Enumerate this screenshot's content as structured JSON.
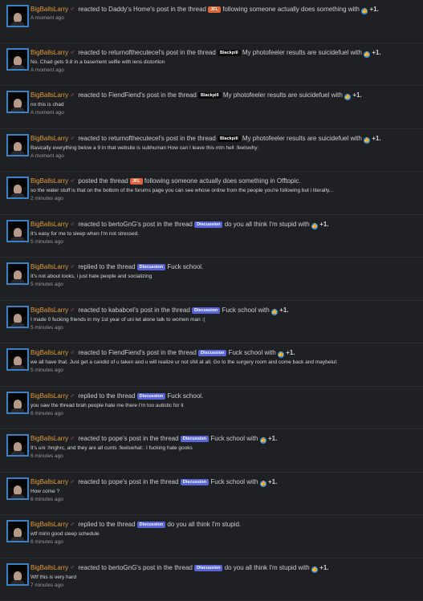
{
  "items": [
    {
      "user": "BigBallsLarry",
      "action": "reacted to Daddy's Home's post in the thread",
      "tag": "JFL",
      "tagType": "jfl",
      "thread": "following someone actually does something with",
      "reaction": "+1.",
      "snippet": "",
      "time": "A moment ago"
    },
    {
      "user": "BigBallsLarry",
      "action": "reacted to returnofthecutecel's post in the thread",
      "tag": "Blackpill",
      "tagType": "bp",
      "thread": "My photofeeler results are suicidefuel with",
      "reaction": "+1.",
      "snippet": "No. Chad gets 9.8 in a basement selfie with lens distortion",
      "time": "A moment ago"
    },
    {
      "user": "BigBallsLarry",
      "action": "reacted to FiendFiend's post in the thread",
      "tag": "Blackpill",
      "tagType": "bp",
      "thread": "My photofeeler results are suicidefuel with",
      "reaction": "+1.",
      "snippet": "no this is chad",
      "time": "A moment ago"
    },
    {
      "user": "BigBallsLarry",
      "action": "reacted to returnofthecutecel's post in the thread",
      "tag": "Blackpill",
      "tagType": "bp",
      "thread": "My photofeeler results are suicidefuel with",
      "reaction": "+1.",
      "snippet": "Basically everything below a 9 in that website is subhuman How can I leave this mtn hell :feelswhy:",
      "time": "A moment ago"
    },
    {
      "user": "BigBallsLarry",
      "action": "posted the thread",
      "tag": "JFL",
      "tagType": "jfl",
      "thread": "following someone actually does something in Offtopic.",
      "reaction": "",
      "snippet": "so the water stuff is that on the bottom of the forums page you can see whose online from the people you're following but i literally...",
      "time": "2 minutes ago"
    },
    {
      "user": "BigBallsLarry",
      "action": "reacted to bertoGnG's post in the thread",
      "tag": "Discussion",
      "tagType": "disc",
      "thread": "do you all think I'm stupid with",
      "reaction": "+1.",
      "snippet": "It's easy for me to sleep when I'm not stressed.",
      "time": "5 minutes ago"
    },
    {
      "user": "BigBallsLarry",
      "action": "replied to the thread",
      "tag": "Discussion",
      "tagType": "disc",
      "thread": "Fuck school.",
      "reaction": "",
      "snippet": "It's not about looks, i just hate people and socializing",
      "time": "5 minutes ago"
    },
    {
      "user": "BigBallsLarry",
      "action": "reacted to kababcel's post in the thread",
      "tag": "Discussion",
      "tagType": "disc",
      "thread": "Fuck school with",
      "reaction": "+1.",
      "snippet": "I made 0 fucking friends in my 1st year of uni let alone talk to women man :(",
      "time": "5 minutes ago"
    },
    {
      "user": "BigBallsLarry",
      "action": "reacted to FiendFiend's post in the thread",
      "tag": "Discussion",
      "tagType": "disc",
      "thread": "Fuck school with",
      "reaction": "+1.",
      "snippet": "we all have that. Just get a candid of u taken and u will realize ur not shit at all. Go to the surgery room and come back and maybelul:",
      "time": "5 minutes ago"
    },
    {
      "user": "BigBallsLarry",
      "action": "replied to the thread",
      "tag": "Discussion",
      "tagType": "disc",
      "thread": "Fuck school.",
      "reaction": "",
      "snippet": "you saw the thread brah people hate me there I'm too autistic for it",
      "time": "6 minutes ago"
    },
    {
      "user": "BigBallsLarry",
      "action": "reacted to pope's post in the thread",
      "tag": "Discussion",
      "tagType": "disc",
      "thread": "Fuck school with",
      "reaction": "+1.",
      "snippet": "It's uni :hnghrc, and they are all cunts :feelswhat:. I fucking hate gooks",
      "time": "6 minutes ago"
    },
    {
      "user": "BigBallsLarry",
      "action": "reacted to pope's post in the thread",
      "tag": "Discussion",
      "tagType": "disc",
      "thread": "Fuck school with",
      "reaction": "+1.",
      "snippet": "How come ?",
      "time": "6 minutes ago"
    },
    {
      "user": "BigBallsLarry",
      "action": "replied to the thread",
      "tag": "Discussion",
      "tagType": "disc",
      "thread": "do you all think I'm stupid.",
      "reaction": "",
      "snippet": "wtf mirin good sleep schedule",
      "time": "6 minutes ago"
    },
    {
      "user": "BigBallsLarry",
      "action": "reacted to bertoGnG's post in the thread",
      "tag": "Discussion",
      "tagType": "disc",
      "thread": "do you all think I'm stupid with",
      "reaction": "+1.",
      "snippet": "Wtf this is very hard",
      "time": "7 minutes ago"
    }
  ]
}
